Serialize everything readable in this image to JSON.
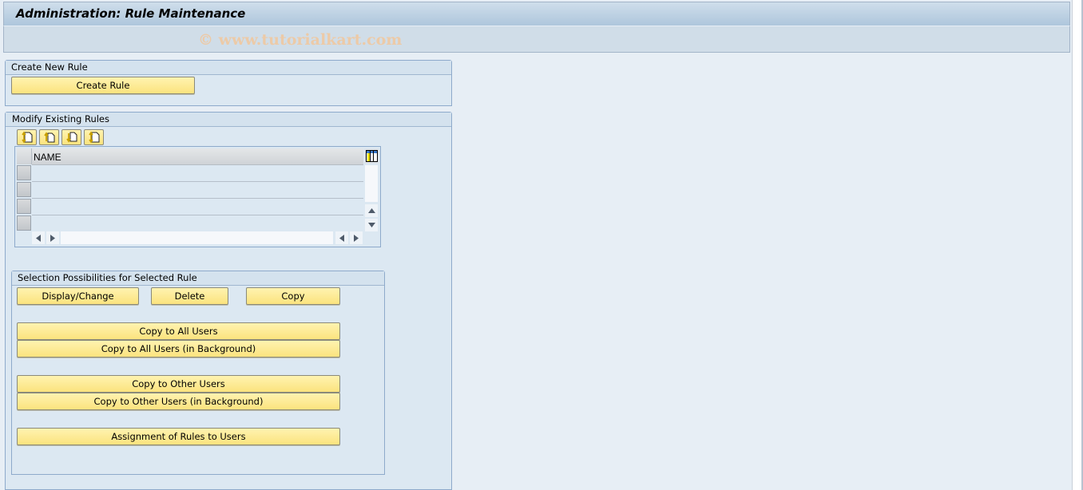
{
  "window": {
    "title": "Administration: Rule Maintenance",
    "watermark": "© www.tutorialkart.com"
  },
  "create_group": {
    "title": "Create New Rule",
    "create_button": "Create Rule"
  },
  "modify_group": {
    "title": "Modify Existing Rules",
    "toolbar_icons": [
      "sort-ascending-icon",
      "insert-row-above-icon",
      "insert-row-below-icon",
      "sort-descending-icon"
    ],
    "table": {
      "columns": [
        "NAME"
      ],
      "rows": [
        "",
        "",
        "",
        ""
      ],
      "layout_icon": "column-layout-icon"
    }
  },
  "selection_group": {
    "title": "Selection Possibilities for Selected Rule",
    "buttons": {
      "display_change": "Display/Change",
      "delete": "Delete",
      "copy": "Copy",
      "copy_all": "Copy to All Users",
      "copy_all_bg": "Copy to All Users (in Background)",
      "copy_other": "Copy to Other Users",
      "copy_other_bg": "Copy to Other Users (in Background)",
      "assignment": "Assignment of Rules to Users"
    }
  },
  "colors": {
    "button_yellow": "#fbe37e",
    "panel_blue": "#dce8f2",
    "title_blue": "#aec6dc",
    "watermark": "#f0c8a0"
  }
}
